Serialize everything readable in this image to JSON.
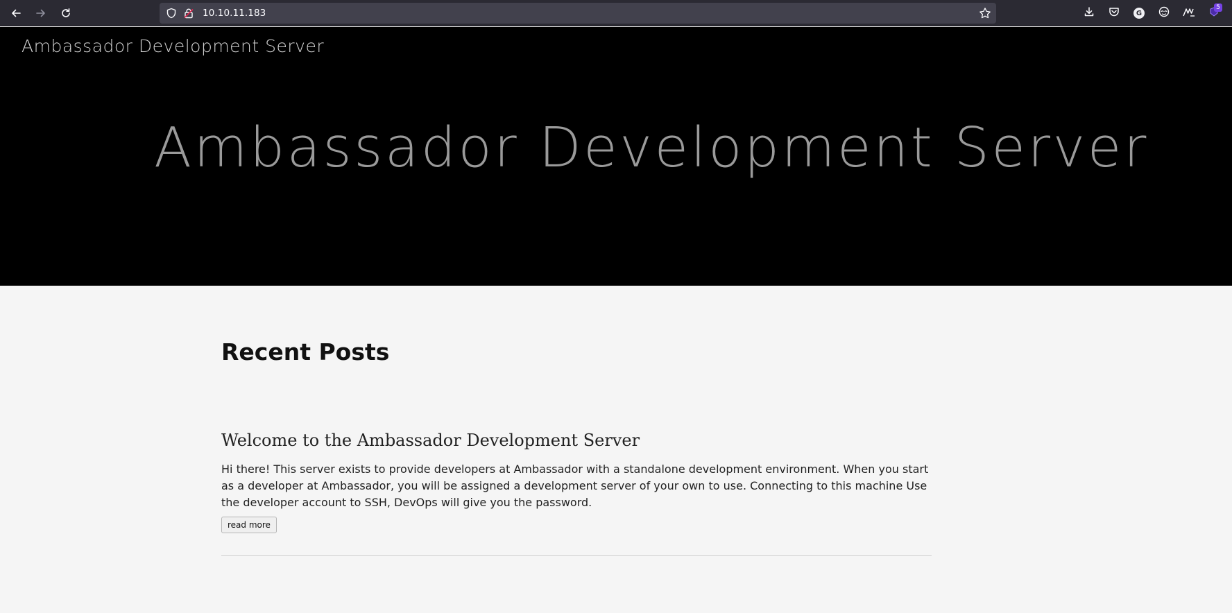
{
  "browser": {
    "url": "10.10.11.183",
    "extensions_badge": "5",
    "account_initial": "G"
  },
  "site": {
    "nav_title": "Ambassador Development Server",
    "hero_title": "Ambassador Development Server"
  },
  "main": {
    "section_heading": "Recent Posts",
    "posts": [
      {
        "title": "Welcome to the Ambassador Development Server",
        "excerpt": "Hi there! This server exists to provide developers at Ambassador with a standalone development environment. When you start as a developer at Ambassador, you will be assigned a development server of your own to use. Connecting to this machine Use the developer account to SSH, DevOps will give you the password.",
        "read_more_label": "read more"
      }
    ]
  },
  "colors": {
    "chrome_bg": "#2b2a33",
    "urlbar_bg": "#42414d",
    "hero_bg": "#000000",
    "page_bg": "#f5f5f5",
    "badge_bg": "#7542e5"
  }
}
